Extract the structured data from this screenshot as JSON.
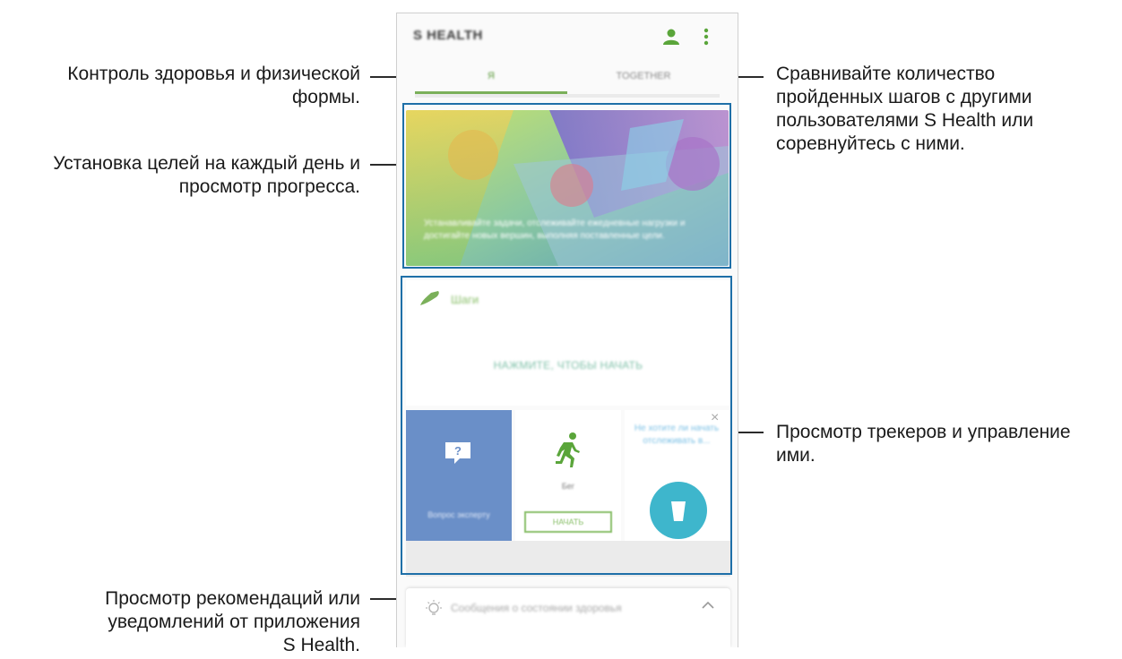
{
  "annotations": {
    "tabs_note": [
      "Контроль здоровья и физической",
      "формы."
    ],
    "goals_note": [
      "Установка целей на каждый день и",
      "просмотр прогресса."
    ],
    "together_note": [
      "Сравнивайте количество",
      "пройденных шагов с другими",
      "пользователями S Health или",
      "соревнуйтесь с ними."
    ],
    "trackers_note": [
      "Просмотр трекеров и управление",
      "ими."
    ],
    "tips_note": [
      "Просмотр рекомендаций или",
      "уведомлений от приложения",
      "S Health."
    ]
  },
  "app": {
    "title": "S HEALTH",
    "tabs": [
      {
        "label": "Я",
        "active": true
      },
      {
        "label": "TOGETHER",
        "active": false
      }
    ]
  },
  "banner": {
    "text": "Устанавливайте задачи, отслеживайте ежедневные нагрузки и достигайте новых вершин, выполняя поставленные цели."
  },
  "steps_card": {
    "title": "Шаги",
    "cta": "НАЖМИТЕ, ЧТОБЫ НАЧАТЬ"
  },
  "tiles": {
    "expert": {
      "label": "Вопрос эксперту",
      "icon": "question-bubble-icon"
    },
    "run": {
      "label": "Бег",
      "button": "НАЧАТЬ",
      "icon": "running-icon"
    },
    "water": {
      "text": "Не хотите ли начать отслеживать в...",
      "icon": "water-cup-icon",
      "close": "×"
    }
  },
  "bottom_bar": {
    "text": "Сообщения о состоянии здоровья",
    "icon": "lightbulb-icon"
  },
  "colors": {
    "accent_green": "#7bb05a",
    "frame_blue": "#1e6fa8",
    "expert_blue": "#6a8fc8",
    "water_teal": "#3eb6cc"
  }
}
